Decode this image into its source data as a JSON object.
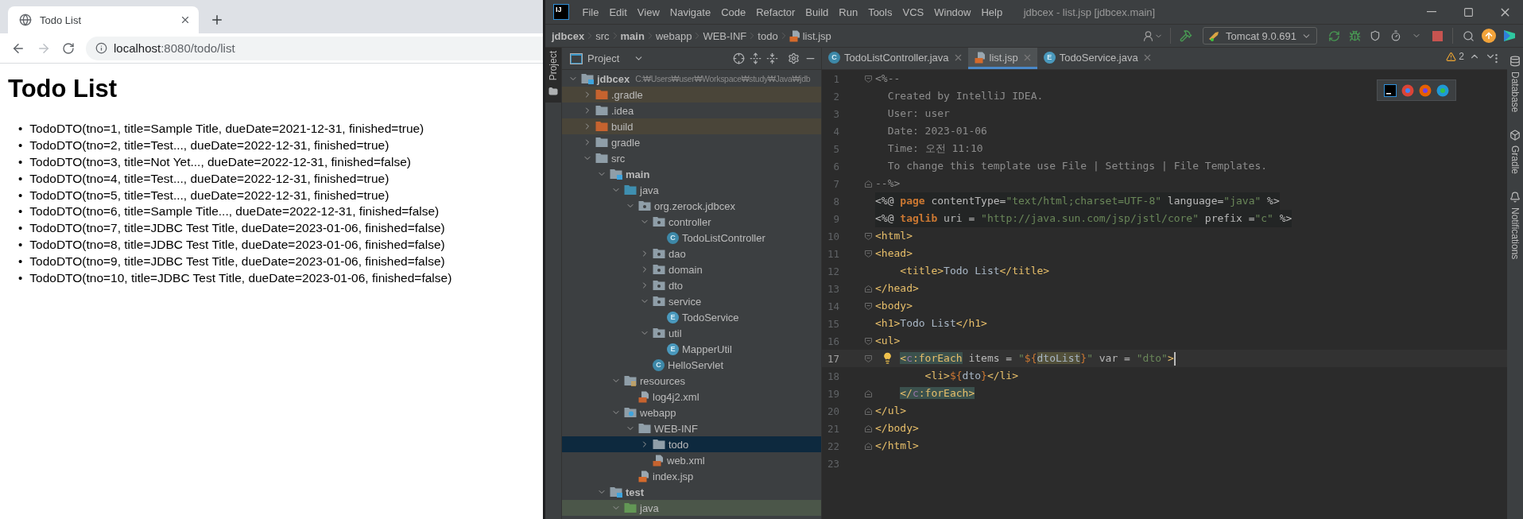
{
  "browser": {
    "tab": {
      "title": "Todo List"
    },
    "address": {
      "host": "localhost",
      "path": ":8080/todo/list"
    },
    "page": {
      "heading": "Todo List",
      "marker": "•",
      "items": [
        "TodoDTO(tno=1, title=Sample Title, dueDate=2021-12-31, finished=true)",
        "TodoDTO(tno=2, title=Test..., dueDate=2022-12-31, finished=true)",
        "TodoDTO(tno=3, title=Not Yet..., dueDate=2022-12-31, finished=false)",
        "TodoDTO(tno=4, title=Test..., dueDate=2022-12-31, finished=true)",
        "TodoDTO(tno=5, title=Test..., dueDate=2022-12-31, finished=true)",
        "TodoDTO(tno=6, title=Sample Title..., dueDate=2022-12-31, finished=false)",
        "TodoDTO(tno=7, title=JDBC Test Title, dueDate=2023-01-06, finished=false)",
        "TodoDTO(tno=8, title=JDBC Test Title, dueDate=2023-01-06, finished=false)",
        "TodoDTO(tno=9, title=JDBC Test Title, dueDate=2023-01-06, finished=false)",
        "TodoDTO(tno=10, title=JDBC Test Title, dueDate=2023-01-06, finished=false)"
      ]
    }
  },
  "ide": {
    "logo": "IJ",
    "menu": [
      "File",
      "Edit",
      "View",
      "Navigate",
      "Code",
      "Refactor",
      "Build",
      "Run",
      "Tools",
      "VCS",
      "Window",
      "Help"
    ],
    "window_title": "jdbcex - list.jsp [jdbcex.main]",
    "breadcrumbs": [
      {
        "label": "jdbcex",
        "bold": true,
        "kind": "dir"
      },
      {
        "label": "src",
        "bold": false,
        "kind": "dir"
      },
      {
        "label": "main",
        "bold": true,
        "kind": "dir"
      },
      {
        "label": "webapp",
        "bold": false,
        "kind": "dir"
      },
      {
        "label": "WEB-INF",
        "bold": false,
        "kind": "dir"
      },
      {
        "label": "todo",
        "bold": false,
        "kind": "dir"
      },
      {
        "label": "list.jsp",
        "bold": false,
        "kind": "jsp"
      }
    ],
    "run_config": "Tomcat 9.0.691",
    "left_stripe": [
      {
        "label": "Project",
        "selected": true
      }
    ],
    "project_panel": {
      "title": "Project",
      "tree": [
        {
          "label": "jdbcex",
          "kind": "module",
          "path": "C:₩Users₩user₩Workspace₩study₩Java₩jdb",
          "expanded": true,
          "selected": false,
          "children": [
            {
              "label": ".gradle",
              "kind": "excluded",
              "expanded": false,
              "selected": false
            },
            {
              "label": ".idea",
              "kind": "folder",
              "expanded": false,
              "selected": false
            },
            {
              "label": "build",
              "kind": "excluded",
              "expanded": false,
              "selected": false
            },
            {
              "label": "gradle",
              "kind": "folder",
              "expanded": false,
              "selected": false
            },
            {
              "label": "src",
              "kind": "folder",
              "expanded": true,
              "selected": false,
              "children": [
                {
                  "label": "main",
                  "kind": "root",
                  "expanded": true,
                  "selected": false,
                  "children": [
                    {
                      "label": "java",
                      "kind": "source",
                      "expanded": true,
                      "selected": false,
                      "children": [
                        {
                          "label": "org.zerock.jdbcex",
                          "kind": "package",
                          "expanded": true,
                          "selected": false,
                          "children": [
                            {
                              "label": "controller",
                              "kind": "package",
                              "expanded": true,
                              "selected": false,
                              "children": [
                                {
                                  "label": "TodoListController",
                                  "kind": "class",
                                  "badge": "C",
                                  "selected": false
                                }
                              ]
                            },
                            {
                              "label": "dao",
                              "kind": "package",
                              "expanded": false,
                              "selected": false
                            },
                            {
                              "label": "domain",
                              "kind": "package",
                              "expanded": false,
                              "selected": false
                            },
                            {
                              "label": "dto",
                              "kind": "package",
                              "expanded": false,
                              "selected": false
                            },
                            {
                              "label": "service",
                              "kind": "package",
                              "expanded": true,
                              "selected": false,
                              "children": [
                                {
                                  "label": "TodoService",
                                  "kind": "enum",
                                  "badge": "E",
                                  "selected": false
                                }
                              ]
                            },
                            {
                              "label": "util",
                              "kind": "package",
                              "expanded": true,
                              "selected": false,
                              "children": [
                                {
                                  "label": "MapperUtil",
                                  "kind": "enum",
                                  "badge": "E",
                                  "selected": false
                                }
                              ]
                            },
                            {
                              "label": "HelloServlet",
                              "kind": "class",
                              "badge": "C",
                              "selected": false
                            }
                          ]
                        }
                      ]
                    },
                    {
                      "label": "resources",
                      "kind": "resources",
                      "expanded": true,
                      "selected": false,
                      "children": [
                        {
                          "label": "log4j2.xml",
                          "kind": "xml",
                          "selected": false
                        }
                      ]
                    },
                    {
                      "label": "webapp",
                      "kind": "webapp",
                      "expanded": true,
                      "selected": false,
                      "children": [
                        {
                          "label": "WEB-INF",
                          "kind": "folder",
                          "expanded": true,
                          "selected": false,
                          "children": [
                            {
                              "label": "todo",
                              "kind": "folder",
                              "expanded": false,
                              "selected": true
                            },
                            {
                              "label": "web.xml",
                              "kind": "xml",
                              "selected": false
                            }
                          ]
                        },
                        {
                          "label": "index.jsp",
                          "kind": "jsp",
                          "selected": false
                        }
                      ]
                    }
                  ]
                },
                {
                  "label": "test",
                  "kind": "root",
                  "expanded": true,
                  "selected": false,
                  "children": [
                    {
                      "label": "java",
                      "kind": "test-source",
                      "expanded": true,
                      "selected": false
                    }
                  ]
                }
              ]
            }
          ]
        }
      ]
    },
    "editor_tabs": [
      {
        "label": "TodoListController.java",
        "kind": "class",
        "badge": "C",
        "selected": false
      },
      {
        "label": "list.jsp",
        "kind": "jsp",
        "selected": true
      },
      {
        "label": "TodoService.java",
        "kind": "enum",
        "badge": "E",
        "selected": false
      }
    ],
    "inspections": {
      "count": "2"
    },
    "editor": {
      "lines": [
        {
          "number": "1",
          "fold_open": true,
          "current": false,
          "bulb": false,
          "kind": "plain",
          "tokens": [
            {
              "text": "<%--",
              "kind": "comment"
            }
          ]
        },
        {
          "number": "2",
          "current": false,
          "bulb": false,
          "kind": "plain",
          "tokens": [
            {
              "text": "  Created by IntelliJ IDEA.",
              "kind": "comment"
            }
          ]
        },
        {
          "number": "3",
          "current": false,
          "bulb": false,
          "kind": "plain",
          "tokens": [
            {
              "text": "  User: user",
              "kind": "comment"
            }
          ]
        },
        {
          "number": "4",
          "current": false,
          "bulb": false,
          "kind": "plain",
          "tokens": [
            {
              "text": "  Date: 2023-01-06",
              "kind": "comment"
            }
          ]
        },
        {
          "number": "5",
          "current": false,
          "bulb": false,
          "kind": "plain",
          "tokens": [
            {
              "text": "  Time: 오전 11:10",
              "kind": "comment"
            }
          ]
        },
        {
          "number": "6",
          "current": false,
          "bulb": false,
          "kind": "plain",
          "tokens": [
            {
              "text": "  To change this template use File | Settings | File Templates.",
              "kind": "comment"
            }
          ]
        },
        {
          "number": "7",
          "fold_close": true,
          "current": false,
          "bulb": false,
          "kind": "plain",
          "tokens": [
            {
              "text": "--%>",
              "kind": "comment"
            }
          ]
        },
        {
          "number": "8",
          "current": false,
          "bulb": false,
          "kind": "directive",
          "tokens": [
            {
              "text": "<%@ ",
              "kind": "plain"
            },
            {
              "text": "page",
              "kind": "keyword"
            },
            {
              "text": " contentType=",
              "kind": "attr"
            },
            {
              "text": "\"text/html;charset=UTF-8\"",
              "kind": "string"
            },
            {
              "text": " language=",
              "kind": "attr"
            },
            {
              "text": "\"java\"",
              "kind": "string"
            },
            {
              "text": " %>",
              "kind": "plain"
            }
          ]
        },
        {
          "number": "9",
          "current": false,
          "bulb": false,
          "kind": "directive",
          "tokens": [
            {
              "text": "<%@ ",
              "kind": "plain"
            },
            {
              "text": "taglib",
              "kind": "keyword"
            },
            {
              "text": " uri = ",
              "kind": "attr"
            },
            {
              "text": "\"http://java.sun.com/jsp/jstl/core\"",
              "kind": "string"
            },
            {
              "text": " prefix =",
              "kind": "attr"
            },
            {
              "text": "\"c\"",
              "kind": "string"
            },
            {
              "text": " %>",
              "kind": "plain"
            }
          ]
        },
        {
          "number": "10",
          "fold_open": true,
          "current": false,
          "bulb": false,
          "kind": "plain",
          "tokens": [
            {
              "text": "<html>",
              "kind": "tag"
            }
          ]
        },
        {
          "number": "11",
          "fold_open": true,
          "current": false,
          "bulb": false,
          "kind": "plain",
          "tokens": [
            {
              "text": "<head>",
              "kind": "tag"
            }
          ]
        },
        {
          "number": "12",
          "current": false,
          "bulb": false,
          "kind": "plain",
          "tokens": [
            {
              "text": "    <title>",
              "kind": "tag"
            },
            {
              "text": "Todo List",
              "kind": "text"
            },
            {
              "text": "</title>",
              "kind": "tag"
            }
          ]
        },
        {
          "number": "13",
          "fold_close": true,
          "current": false,
          "bulb": false,
          "kind": "plain",
          "tokens": [
            {
              "text": "</head>",
              "kind": "tag"
            }
          ]
        },
        {
          "number": "14",
          "fold_open": true,
          "current": false,
          "bulb": false,
          "kind": "plain",
          "tokens": [
            {
              "text": "<body>",
              "kind": "tag"
            }
          ]
        },
        {
          "number": "15",
          "current": false,
          "bulb": false,
          "kind": "plain",
          "tokens": [
            {
              "text": "<h1>",
              "kind": "tag"
            },
            {
              "text": "Todo List",
              "kind": "text"
            },
            {
              "text": "</h1>",
              "kind": "tag"
            }
          ]
        },
        {
          "number": "16",
          "fold_open": true,
          "current": false,
          "bulb": false,
          "kind": "plain",
          "tokens": [
            {
              "text": "<ul>",
              "kind": "tag"
            }
          ]
        },
        {
          "number": "17",
          "fold_open": true,
          "current": true,
          "bulb": true,
          "kind": "nested",
          "tokens": [
            {
              "text": "<",
              "kind": "tag-hl"
            },
            {
              "text": "c",
              "kind": "ns-hl"
            },
            {
              "text": ":forEach",
              "kind": "tag-hl"
            },
            {
              "text": " items = ",
              "kind": "attr"
            },
            {
              "text": "\"",
              "kind": "string"
            },
            {
              "text": "${",
              "kind": "el"
            },
            {
              "text": "dtoList",
              "kind": "usage"
            },
            {
              "text": "}",
              "kind": "el"
            },
            {
              "text": "\"",
              "kind": "string"
            },
            {
              "text": " var = ",
              "kind": "attr"
            },
            {
              "text": "\"dto\"",
              "kind": "string"
            },
            {
              "text": ">",
              "kind": "tag"
            }
          ]
        },
        {
          "number": "18",
          "current": false,
          "bulb": false,
          "kind": "plain",
          "tokens": [
            {
              "text": "        <li>",
              "kind": "tag"
            },
            {
              "text": "${",
              "kind": "el"
            },
            {
              "text": "dto",
              "kind": "text"
            },
            {
              "text": "}",
              "kind": "el"
            },
            {
              "text": "</li>",
              "kind": "tag"
            }
          ]
        },
        {
          "number": "19",
          "fold_close": true,
          "current": false,
          "bulb": false,
          "kind": "nested",
          "tokens": [
            {
              "text": "</",
              "kind": "tag-hl"
            },
            {
              "text": "c",
              "kind": "ns-hl"
            },
            {
              "text": ":forEach>",
              "kind": "tag-hl"
            }
          ]
        },
        {
          "number": "20",
          "fold_close": true,
          "current": false,
          "bulb": false,
          "kind": "plain",
          "tokens": [
            {
              "text": "</ul>",
              "kind": "tag"
            }
          ]
        },
        {
          "number": "21",
          "fold_close": true,
          "current": false,
          "bulb": false,
          "kind": "plain",
          "tokens": [
            {
              "text": "</body>",
              "kind": "tag"
            }
          ]
        },
        {
          "number": "22",
          "fold_close": true,
          "current": false,
          "bulb": false,
          "kind": "plain",
          "tokens": [
            {
              "text": "</html>",
              "kind": "tag"
            }
          ]
        },
        {
          "number": "23",
          "current": false,
          "bulb": false
        }
      ]
    },
    "right_stripe": [
      {
        "label": "Database",
        "kind": "database"
      },
      {
        "label": "Gradle",
        "kind": "gradle"
      },
      {
        "label": "Notifications",
        "kind": "bell"
      }
    ]
  }
}
